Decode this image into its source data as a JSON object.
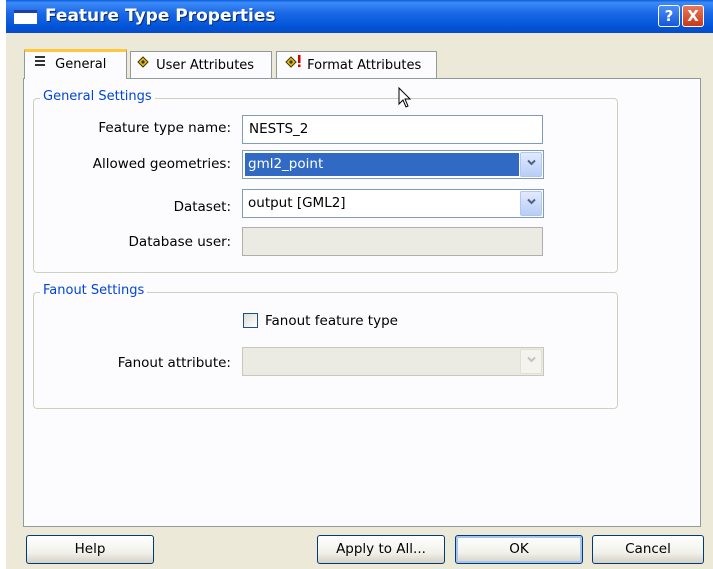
{
  "window": {
    "title": "Feature Type Properties",
    "help_glyph": "?",
    "close_glyph": "X"
  },
  "tabs": [
    {
      "label": "General",
      "icon": "list-icon",
      "active": true
    },
    {
      "label": "User Attributes",
      "icon": "attribute-icon",
      "active": false
    },
    {
      "label": "Format Attributes",
      "icon": "format-attribute-icon",
      "active": false
    }
  ],
  "general_settings": {
    "legend": "General Settings",
    "feature_type_name": {
      "label": "Feature type name:",
      "value": "NESTS_2"
    },
    "allowed_geometries": {
      "label": "Allowed geometries:",
      "value": "gml2_point"
    },
    "dataset": {
      "label": "Dataset:",
      "value": "output [GML2]"
    },
    "database_user": {
      "label": "Database user:",
      "value": ""
    }
  },
  "fanout_settings": {
    "legend": "Fanout Settings",
    "fanout_feature_type": {
      "label": "Fanout feature type",
      "checked": false
    },
    "fanout_attribute": {
      "label": "Fanout attribute:",
      "value": ""
    }
  },
  "buttons": {
    "help": "Help",
    "apply_all": "Apply to All...",
    "ok": "OK",
    "cancel": "Cancel"
  },
  "colors": {
    "titlebar": "#0052d6",
    "legend_text": "#0046d5",
    "selection": "#316ac5",
    "dialog_bg": "#ece9d8"
  }
}
